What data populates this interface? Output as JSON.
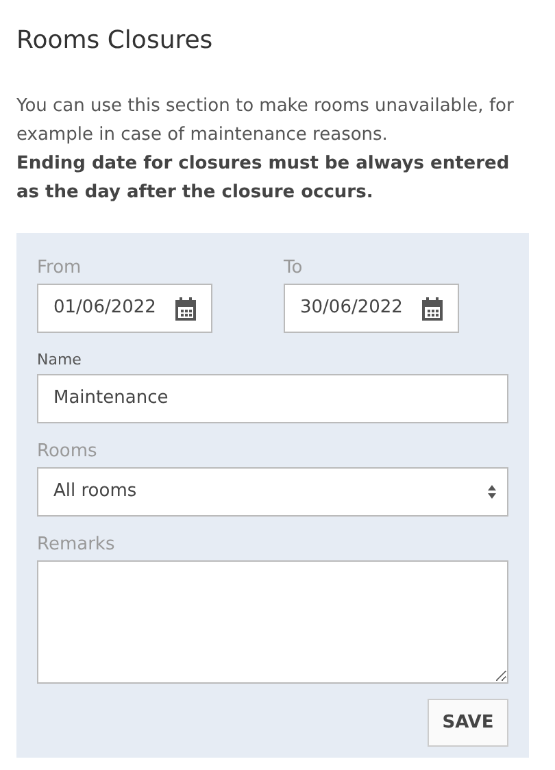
{
  "title": "Rooms Closures",
  "intro": "You can use this section to make rooms unavailable, for example in case of maintenance reasons.",
  "notice": "Ending date for closures must be always entered as the day after the closure occurs.",
  "form": {
    "dates": [
      {
        "label": "From",
        "value": "01/06/2022",
        "focused": false
      },
      {
        "label": "To",
        "value": "30/06/2022",
        "focused": false
      }
    ],
    "fields": [
      {
        "kind": "text",
        "label": "Name",
        "value": "Maintenance",
        "focused": true
      },
      {
        "kind": "select",
        "label": "Rooms",
        "value": "All rooms",
        "focused": false
      },
      {
        "kind": "textarea",
        "label": "Remarks",
        "focused": false
      }
    ],
    "button": "SAVE"
  }
}
